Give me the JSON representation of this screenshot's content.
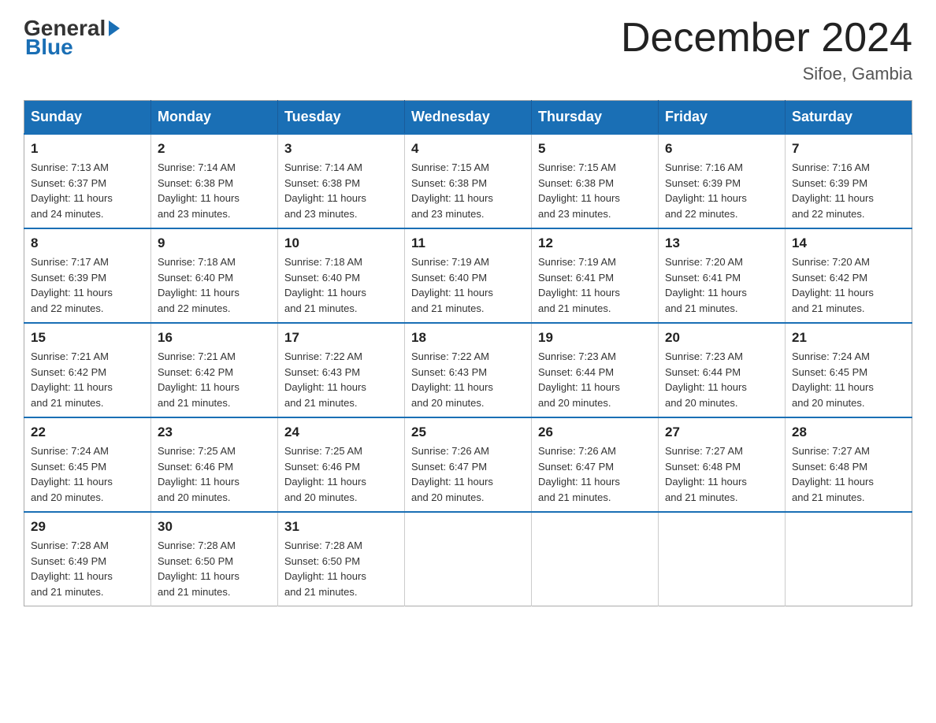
{
  "header": {
    "logo_general": "General",
    "logo_blue": "Blue",
    "month_title": "December 2024",
    "subtitle": "Sifoe, Gambia"
  },
  "calendar": {
    "days_of_week": [
      "Sunday",
      "Monday",
      "Tuesday",
      "Wednesday",
      "Thursday",
      "Friday",
      "Saturday"
    ],
    "weeks": [
      [
        {
          "day": "1",
          "sunrise": "7:13 AM",
          "sunset": "6:37 PM",
          "daylight": "11 hours and 24 minutes."
        },
        {
          "day": "2",
          "sunrise": "7:14 AM",
          "sunset": "6:38 PM",
          "daylight": "11 hours and 23 minutes."
        },
        {
          "day": "3",
          "sunrise": "7:14 AM",
          "sunset": "6:38 PM",
          "daylight": "11 hours and 23 minutes."
        },
        {
          "day": "4",
          "sunrise": "7:15 AM",
          "sunset": "6:38 PM",
          "daylight": "11 hours and 23 minutes."
        },
        {
          "day": "5",
          "sunrise": "7:15 AM",
          "sunset": "6:38 PM",
          "daylight": "11 hours and 23 minutes."
        },
        {
          "day": "6",
          "sunrise": "7:16 AM",
          "sunset": "6:39 PM",
          "daylight": "11 hours and 22 minutes."
        },
        {
          "day": "7",
          "sunrise": "7:16 AM",
          "sunset": "6:39 PM",
          "daylight": "11 hours and 22 minutes."
        }
      ],
      [
        {
          "day": "8",
          "sunrise": "7:17 AM",
          "sunset": "6:39 PM",
          "daylight": "11 hours and 22 minutes."
        },
        {
          "day": "9",
          "sunrise": "7:18 AM",
          "sunset": "6:40 PM",
          "daylight": "11 hours and 22 minutes."
        },
        {
          "day": "10",
          "sunrise": "7:18 AM",
          "sunset": "6:40 PM",
          "daylight": "11 hours and 21 minutes."
        },
        {
          "day": "11",
          "sunrise": "7:19 AM",
          "sunset": "6:40 PM",
          "daylight": "11 hours and 21 minutes."
        },
        {
          "day": "12",
          "sunrise": "7:19 AM",
          "sunset": "6:41 PM",
          "daylight": "11 hours and 21 minutes."
        },
        {
          "day": "13",
          "sunrise": "7:20 AM",
          "sunset": "6:41 PM",
          "daylight": "11 hours and 21 minutes."
        },
        {
          "day": "14",
          "sunrise": "7:20 AM",
          "sunset": "6:42 PM",
          "daylight": "11 hours and 21 minutes."
        }
      ],
      [
        {
          "day": "15",
          "sunrise": "7:21 AM",
          "sunset": "6:42 PM",
          "daylight": "11 hours and 21 minutes."
        },
        {
          "day": "16",
          "sunrise": "7:21 AM",
          "sunset": "6:42 PM",
          "daylight": "11 hours and 21 minutes."
        },
        {
          "day": "17",
          "sunrise": "7:22 AM",
          "sunset": "6:43 PM",
          "daylight": "11 hours and 21 minutes."
        },
        {
          "day": "18",
          "sunrise": "7:22 AM",
          "sunset": "6:43 PM",
          "daylight": "11 hours and 20 minutes."
        },
        {
          "day": "19",
          "sunrise": "7:23 AM",
          "sunset": "6:44 PM",
          "daylight": "11 hours and 20 minutes."
        },
        {
          "day": "20",
          "sunrise": "7:23 AM",
          "sunset": "6:44 PM",
          "daylight": "11 hours and 20 minutes."
        },
        {
          "day": "21",
          "sunrise": "7:24 AM",
          "sunset": "6:45 PM",
          "daylight": "11 hours and 20 minutes."
        }
      ],
      [
        {
          "day": "22",
          "sunrise": "7:24 AM",
          "sunset": "6:45 PM",
          "daylight": "11 hours and 20 minutes."
        },
        {
          "day": "23",
          "sunrise": "7:25 AM",
          "sunset": "6:46 PM",
          "daylight": "11 hours and 20 minutes."
        },
        {
          "day": "24",
          "sunrise": "7:25 AM",
          "sunset": "6:46 PM",
          "daylight": "11 hours and 20 minutes."
        },
        {
          "day": "25",
          "sunrise": "7:26 AM",
          "sunset": "6:47 PM",
          "daylight": "11 hours and 20 minutes."
        },
        {
          "day": "26",
          "sunrise": "7:26 AM",
          "sunset": "6:47 PM",
          "daylight": "11 hours and 21 minutes."
        },
        {
          "day": "27",
          "sunrise": "7:27 AM",
          "sunset": "6:48 PM",
          "daylight": "11 hours and 21 minutes."
        },
        {
          "day": "28",
          "sunrise": "7:27 AM",
          "sunset": "6:48 PM",
          "daylight": "11 hours and 21 minutes."
        }
      ],
      [
        {
          "day": "29",
          "sunrise": "7:28 AM",
          "sunset": "6:49 PM",
          "daylight": "11 hours and 21 minutes."
        },
        {
          "day": "30",
          "sunrise": "7:28 AM",
          "sunset": "6:50 PM",
          "daylight": "11 hours and 21 minutes."
        },
        {
          "day": "31",
          "sunrise": "7:28 AM",
          "sunset": "6:50 PM",
          "daylight": "11 hours and 21 minutes."
        },
        null,
        null,
        null,
        null
      ]
    ],
    "labels": {
      "sunrise": "Sunrise:",
      "sunset": "Sunset:",
      "daylight": "Daylight:"
    }
  }
}
